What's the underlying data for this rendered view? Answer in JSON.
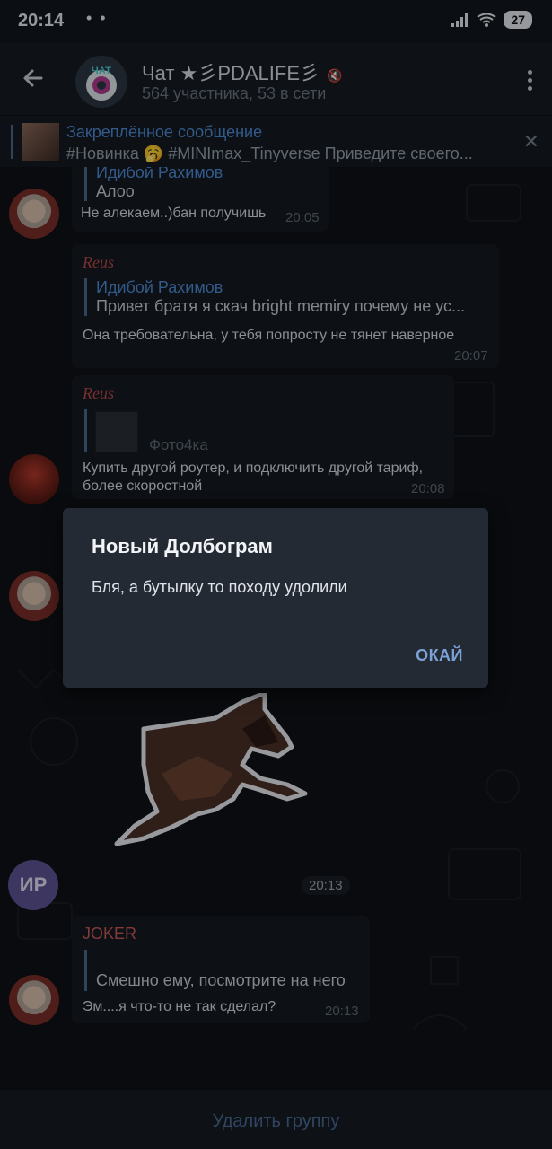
{
  "status_bar": {
    "time": "20:14",
    "notif": "• •",
    "battery": "27"
  },
  "header": {
    "back_icon": "arrow-left",
    "title": "Чат ★彡PDALIFE彡",
    "subtitle": "564 участника, 53 в сети",
    "avatar_text": "ЧАТ"
  },
  "pinned": {
    "title": "Закреплённое сообщение",
    "text": "#Новинка 🥱 #MINImax_Tinyverse Приведите своего..."
  },
  "messages": [
    {
      "quote_name": "Идибой Рахимов",
      "quote_text": "Алоо",
      "text": "Не алекаем..)бан получишь",
      "time": "20:05"
    },
    {
      "sender": "Reus",
      "quote_name": "Идибой Рахимов",
      "quote_text": "Привет братя я скач bright memiry  почему не ус...",
      "text": "Она требовательна, у тебя попросту не тянет наверное",
      "time": "20:07"
    },
    {
      "sender": "Reus",
      "quote_text": "Фото4ка",
      "text_line1": "Купить другой роутер, и подключить другой тариф,",
      "text_line2": "более скоростной",
      "time": "20:08"
    },
    {
      "sticker_time": "20:13",
      "avatar_text": "ИР"
    },
    {
      "sender": "JOKER",
      "quote_text": "Смешно ему, посмотрите на него",
      "text": "Эм....я что-то не так сделал?",
      "time": "20:13"
    }
  ],
  "dialog": {
    "title": "Новый Долбограм",
    "body": "Бля, а бутылку то походу удолили",
    "ok": "ОКАЙ"
  },
  "bottom": {
    "action": "Удалить группу"
  },
  "colors": {
    "accent": "#4e8bd6",
    "reus": "#b44a4a",
    "joker": "#c85a5a",
    "dialog_bg": "#232a33"
  }
}
